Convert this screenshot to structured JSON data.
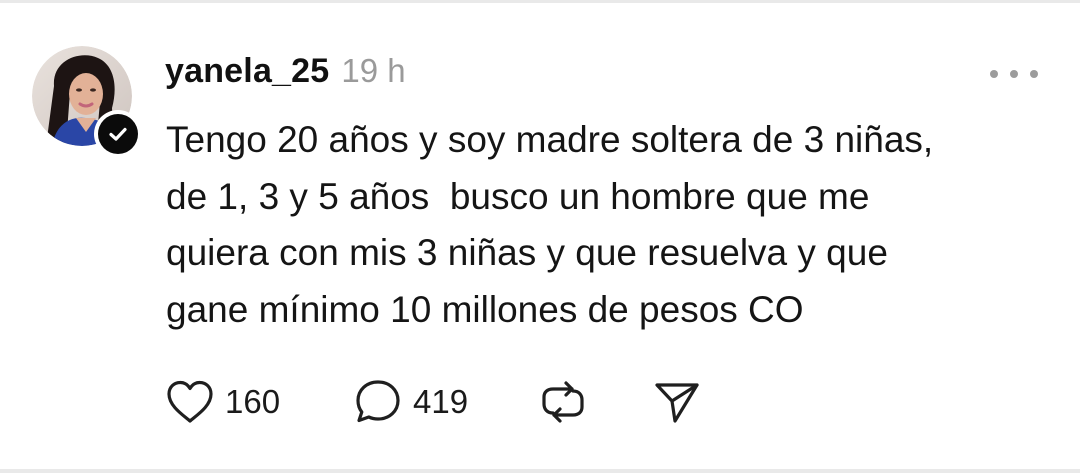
{
  "post": {
    "username": "yanela_25",
    "timestamp": "19 h",
    "text_lines": [
      "Tengo 20 años y soy madre soltera de 3 niñas,",
      "de 1, 3 y 5 años  busco un hombre que me",
      "quiera con mis 3 niñas y que resuelva y que",
      "gane mínimo 10 millones de pesos CO"
    ]
  },
  "actions": {
    "like_count": "160",
    "reply_count": "419"
  },
  "icons": {
    "avatar": "profile-photo",
    "badge": "follow-check-icon",
    "more": "more-options-icon",
    "like": "heart-icon",
    "reply": "comment-bubble-icon",
    "repost": "repost-icon",
    "share": "send-icon"
  }
}
